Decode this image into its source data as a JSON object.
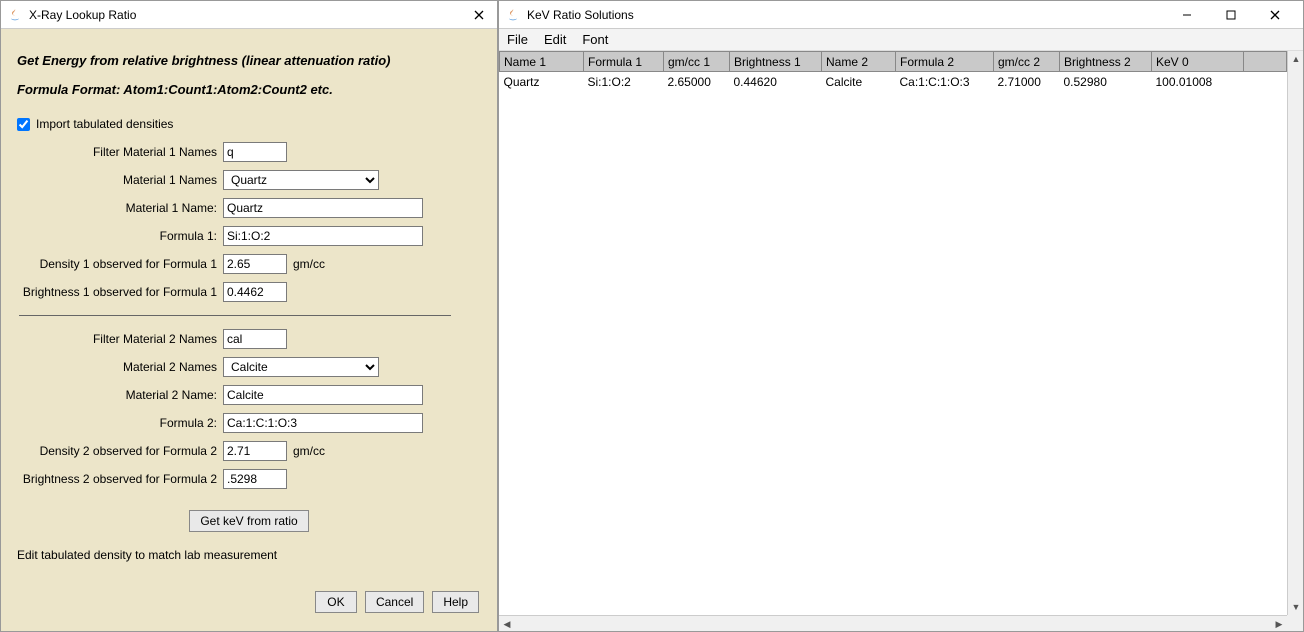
{
  "left_window": {
    "title": "X-Ray Lookup Ratio",
    "heading1": "Get Energy from relative brightness (linear attenuation ratio)",
    "heading2": "Formula Format: Atom1:Count1:Atom2:Count2 etc.",
    "import_densities_label": "Import tabulated densities",
    "import_densities_checked": true,
    "labels": {
      "filter1": "Filter Material 1 Names",
      "names1": "Material 1 Names",
      "name1": "Material 1 Name:",
      "formula1": "Formula 1:",
      "density1": "Density 1 observed for Formula 1",
      "brightness1": "Brightness 1 observed for Formula 1",
      "filter2": "Filter Material 2 Names",
      "names2": "Material 2 Names",
      "name2": "Material 2 Name:",
      "formula2": "Formula 2:",
      "density2": "Density 2 observed for Formula 2",
      "brightness2": "Brightness 2 observed for Formula 2",
      "gmcc": "gm/cc"
    },
    "values": {
      "filter1": "q",
      "names1_selected": "Quartz",
      "name1": "Quartz",
      "formula1": "Si:1:O:2",
      "density1": "2.65",
      "brightness1": "0.4462",
      "filter2": "cal",
      "names2_selected": "Calcite",
      "name2": "Calcite",
      "formula2": "Ca:1:C:1:O:3",
      "density2": "2.71",
      "brightness2": ".5298"
    },
    "get_kev_button": "Get keV from ratio",
    "footer_note": "Edit tabulated density to match lab measurement",
    "buttons": {
      "ok": "OK",
      "cancel": "Cancel",
      "help": "Help"
    }
  },
  "right_window": {
    "title": "KeV Ratio Solutions",
    "menu": {
      "file": "File",
      "edit": "Edit",
      "font": "Font"
    },
    "table": {
      "headers": [
        "Name 1",
        "Formula 1",
        "gm/cc 1",
        "Brightness 1",
        "Name 2",
        "Formula 2",
        "gm/cc 2",
        "Brightness 2",
        "KeV 0",
        ""
      ],
      "rows": [
        [
          "Quartz",
          "Si:1:O:2",
          "2.65000",
          "0.44620",
          "Calcite",
          "Ca:1:C:1:O:3",
          "2.71000",
          "0.52980",
          "100.01008",
          ""
        ]
      ]
    }
  }
}
